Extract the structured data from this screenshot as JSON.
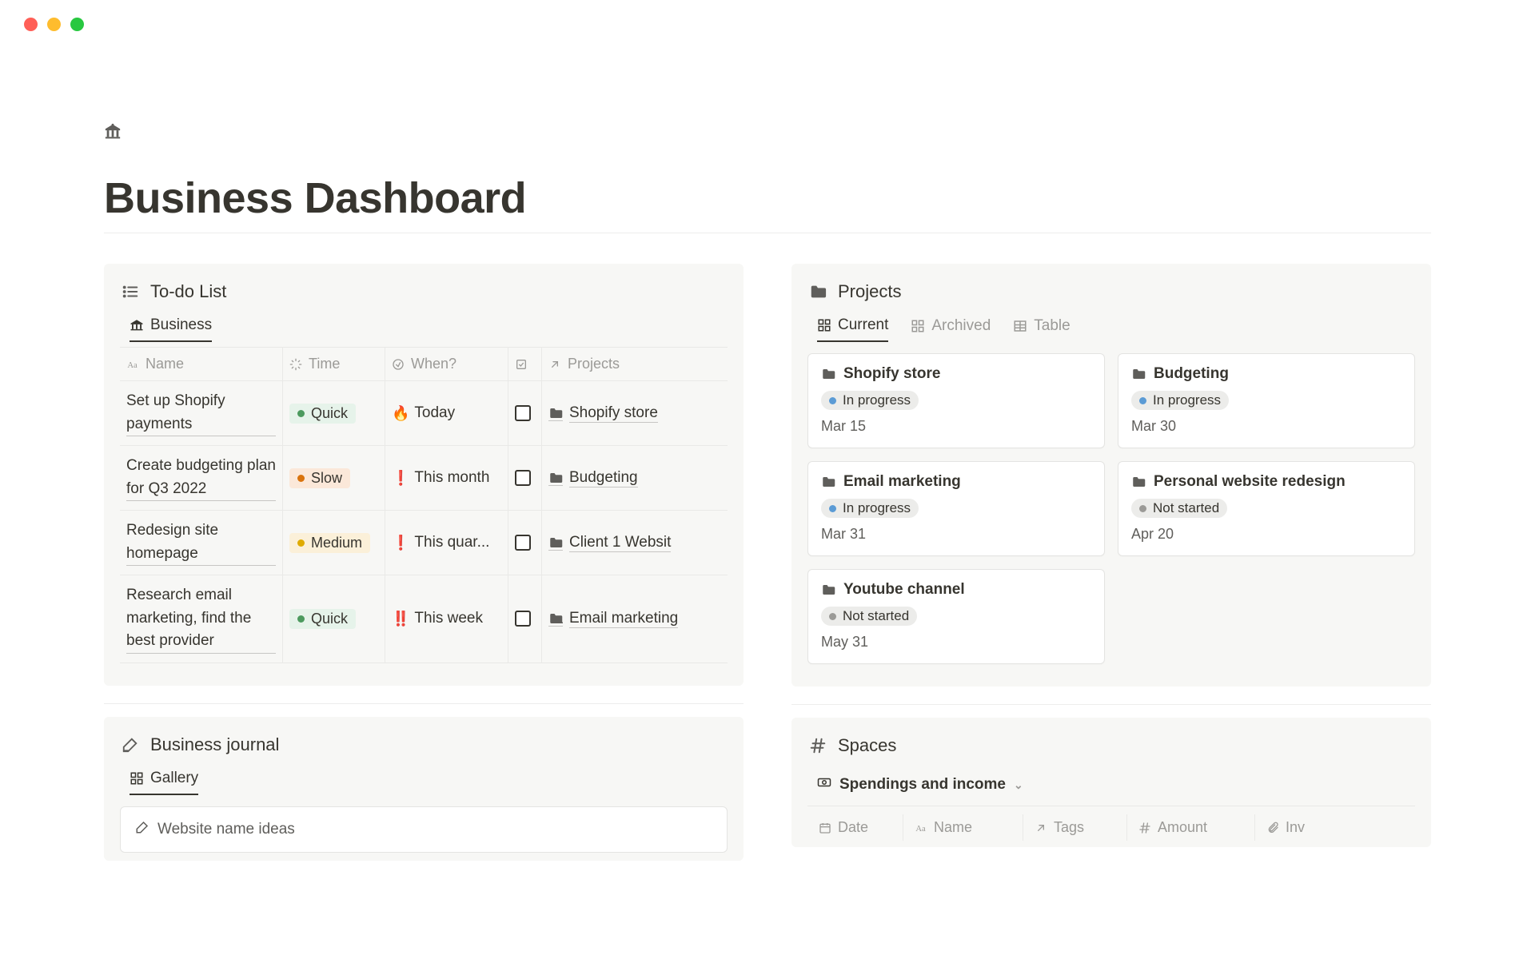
{
  "page": {
    "title": "Business Dashboard",
    "icon": "bank"
  },
  "todo": {
    "title": "To-do List",
    "tab": "Business",
    "columns": {
      "name": "Name",
      "time": "Time",
      "when": "When?",
      "check": "",
      "projects": "Projects"
    },
    "rows": [
      {
        "name": "Set up Shopify payments",
        "time": "Quick",
        "time_color": "green",
        "when_emoji": "🔥",
        "when": "Today",
        "project": "Shopify store"
      },
      {
        "name": "Create budgeting plan for Q3 2022",
        "time": "Slow",
        "time_color": "orange",
        "when_emoji": "❗",
        "when": "This month",
        "project": "Budgeting"
      },
      {
        "name": "Redesign site homepage",
        "time": "Medium",
        "time_color": "yellow",
        "when_emoji": "❗",
        "when": "This quar...",
        "project": "Client 1 Websit"
      },
      {
        "name": "Research email marketing, find the best provider",
        "time": "Quick",
        "time_color": "green",
        "when_emoji": "‼️",
        "when": "This week",
        "project": "Email marketing"
      }
    ]
  },
  "projects": {
    "title": "Projects",
    "tabs": {
      "current": "Current",
      "archived": "Archived",
      "table": "Table"
    },
    "cards": [
      {
        "title": "Shopify store",
        "status": "In progress",
        "status_dot": "blue",
        "date": "Mar 15"
      },
      {
        "title": "Budgeting",
        "status": "In progress",
        "status_dot": "blue",
        "date": "Mar 30"
      },
      {
        "title": "Email marketing",
        "status": "In progress",
        "status_dot": "blue",
        "date": "Mar 31"
      },
      {
        "title": "Personal website redesign",
        "status": "Not started",
        "status_dot": "grey",
        "date": "Apr 20"
      },
      {
        "title": "Youtube channel",
        "status": "Not started",
        "status_dot": "grey",
        "date": "May 31"
      }
    ]
  },
  "journal": {
    "title": "Business journal",
    "tab": "Gallery",
    "card": "Website name ideas"
  },
  "spaces": {
    "title": "Spaces",
    "subtitle": "Spendings and income",
    "columns": {
      "date": "Date",
      "name": "Name",
      "tags": "Tags",
      "amount": "Amount",
      "inv": "Inv"
    }
  }
}
